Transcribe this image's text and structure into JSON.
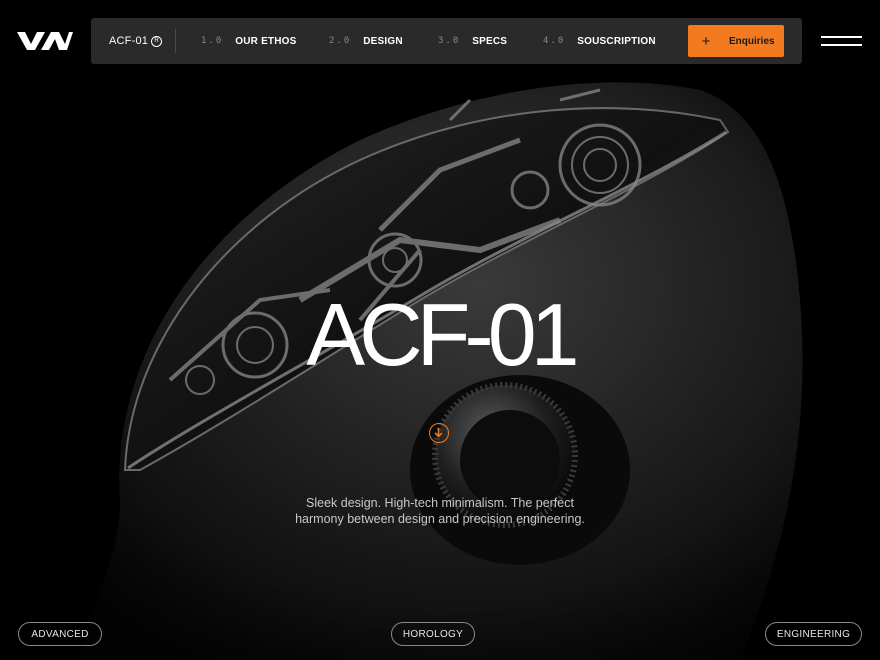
{
  "header": {
    "brand": "ACF-01",
    "reg_mark": "R",
    "nav": [
      {
        "num": "1.0",
        "label": "OUR ETHOS"
      },
      {
        "num": "2.0",
        "label": "DESIGN"
      },
      {
        "num": "3.0",
        "label": "SPECS"
      },
      {
        "num": "4.0",
        "label": "SOUSCRIPTION"
      }
    ],
    "cta": {
      "icon": "+",
      "label": "Enquiries"
    }
  },
  "hero": {
    "title": "ACF-01",
    "tagline": "Sleek design. High-tech minimalism. The perfect harmony between design and precision engineering."
  },
  "tags": [
    "ADVANCED",
    "HOROLOGY",
    "ENGINEERING"
  ],
  "colors": {
    "accent": "#f47a1f",
    "background": "#000000",
    "bar": "#2a2a2a"
  },
  "icons": {
    "logo": "vv-logo-icon",
    "menu": "hamburger-menu-icon",
    "scroll": "arrow-down-circle-icon",
    "cta": "plus-icon"
  }
}
